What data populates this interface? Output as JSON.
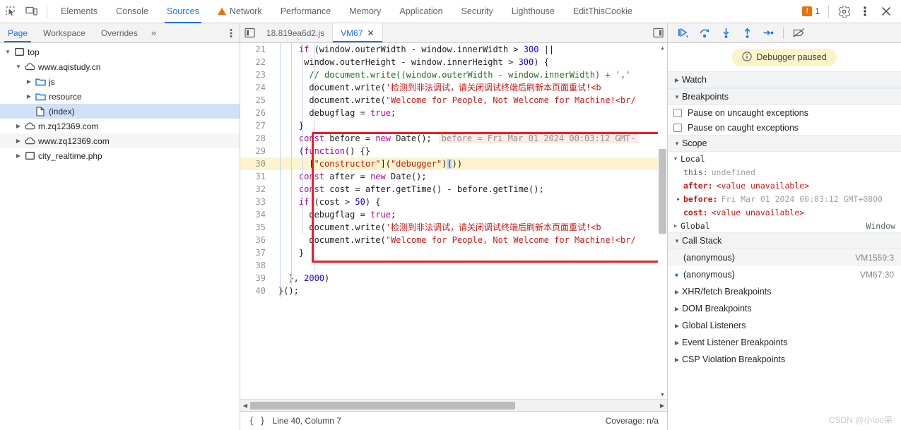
{
  "toolbar": {
    "inspect_icon": "inspect-cursor-icon",
    "device_icon": "device-toolbar-icon",
    "tabs": [
      {
        "label": "Elements",
        "active": false,
        "warning": false
      },
      {
        "label": "Console",
        "active": false,
        "warning": false
      },
      {
        "label": "Sources",
        "active": true,
        "warning": false
      },
      {
        "label": "Network",
        "active": false,
        "warning": true
      },
      {
        "label": "Performance",
        "active": false,
        "warning": false
      },
      {
        "label": "Memory",
        "active": false,
        "warning": false
      },
      {
        "label": "Application",
        "active": false,
        "warning": false
      },
      {
        "label": "Security",
        "active": false,
        "warning": false
      },
      {
        "label": "Lighthouse",
        "active": false,
        "warning": false
      },
      {
        "label": "EditThisCookie",
        "active": false,
        "warning": false
      }
    ],
    "warning_badge": {
      "symbol": "!",
      "count": "1"
    },
    "settings_icon": "gear-icon",
    "kebab_icon": "more-vertical-icon",
    "close_icon": "close-icon"
  },
  "navigator": {
    "tabs": [
      {
        "label": "Page",
        "active": true
      },
      {
        "label": "Workspace",
        "active": false
      },
      {
        "label": "Overrides",
        "active": false
      }
    ],
    "more_label": "»",
    "kebab_icon": "more-vertical-icon",
    "tree": [
      {
        "label": "top",
        "icon": "frame-icon",
        "depth": 0,
        "twisty": "▼",
        "selected": false,
        "striped": false
      },
      {
        "label": "www.aqistudy.cn",
        "icon": "cloud-icon",
        "depth": 1,
        "twisty": "▼",
        "selected": false,
        "striped": false
      },
      {
        "label": "js",
        "icon": "folder-icon",
        "depth": 2,
        "twisty": "▶",
        "selected": false,
        "striped": false
      },
      {
        "label": "resource",
        "icon": "folder-icon",
        "depth": 2,
        "twisty": "▶",
        "selected": false,
        "striped": false
      },
      {
        "label": "(index)",
        "icon": "document-icon",
        "depth": 2,
        "twisty": "",
        "selected": true,
        "striped": false
      },
      {
        "label": "m.zq12369.com",
        "icon": "cloud-icon",
        "depth": 1,
        "twisty": "▶",
        "selected": false,
        "striped": false
      },
      {
        "label": "www.zq12369.com",
        "icon": "cloud-icon",
        "depth": 1,
        "twisty": "▶",
        "selected": false,
        "striped": true
      },
      {
        "label": "city_realtime.php",
        "icon": "frame-icon",
        "depth": 1,
        "twisty": "▶",
        "selected": false,
        "striped": false
      }
    ]
  },
  "editor": {
    "nav_left_icon": "panel-collapse-left-icon",
    "nav_right_icon": "panel-expand-right-icon",
    "tabs": [
      {
        "label": "18.819ea6d2.js",
        "active": false,
        "closable": false
      },
      {
        "label": "VM67",
        "active": true,
        "closable": true,
        "close_label": "✕"
      }
    ],
    "highlighted_line": 30,
    "inline_evaluation": "before = Fri Mar 01 2024 00:03:12 GMT-",
    "lines": [
      {
        "num": "21",
        "code": "    if (window.outerWidth - window.innerWidth > 300 ||"
      },
      {
        "num": "22",
        "code": "     window.outerHeight - window.innerHeight > 300) {"
      },
      {
        "num": "23",
        "code": "      // document.write((window.outerWidth - window.innerWidth) + ','"
      },
      {
        "num": "24",
        "code": "      document.write('检测到非法调试，请关闭调试终端后刷新本页面重试!<b"
      },
      {
        "num": "25",
        "code": "      document.write(\"Welcome for People, Not Welcome for Machine!<br/"
      },
      {
        "num": "26",
        "code": "      debugflag = true;"
      },
      {
        "num": "27",
        "code": "    }"
      },
      {
        "num": "28",
        "code": "    const before = new Date();"
      },
      {
        "num": "29",
        "code": "    (function() {}"
      },
      {
        "num": "30",
        "code": "      [\"constructor\"](\"debugger\")())"
      },
      {
        "num": "31",
        "code": "    const after = new Date();"
      },
      {
        "num": "32",
        "code": "    const cost = after.getTime() - before.getTime();"
      },
      {
        "num": "33",
        "code": "    if (cost > 50) {"
      },
      {
        "num": "34",
        "code": "      debugflag = true;"
      },
      {
        "num": "35",
        "code": "      document.write('检测到非法调试，请关闭调试终端后刷新本页面重试!<b"
      },
      {
        "num": "36",
        "code": "      document.write(\"Welcome for People, Not Welcome for Machine!<br/"
      },
      {
        "num": "37",
        "code": "    }"
      },
      {
        "num": "38",
        "code": ""
      },
      {
        "num": "39",
        "code": "  }, 2000)"
      },
      {
        "num": "40",
        "code": "}();"
      }
    ]
  },
  "status_bar": {
    "pretty_print_icon": "format-braces-icon",
    "position": "Line 40, Column 7",
    "coverage": "Coverage: n/a"
  },
  "debugger": {
    "controls": [
      {
        "name": "resume-script-icon",
        "glyph": "▷"
      },
      {
        "name": "step-over-icon",
        "glyph": "↷"
      },
      {
        "name": "step-into-icon",
        "glyph": "↓"
      },
      {
        "name": "step-out-icon",
        "glyph": "↑"
      },
      {
        "name": "step-icon",
        "glyph": "→"
      },
      {
        "name": "deactivate-breakpoints-icon",
        "glyph": "⊘"
      }
    ],
    "paused_message": "Debugger paused",
    "paused_icon": "info-circle-icon",
    "sections": {
      "watch": {
        "label": "Watch",
        "twisty": "▶"
      },
      "breakpoints": {
        "label": "Breakpoints",
        "twisty": "▼"
      },
      "scope": {
        "label": "Scope",
        "twisty": "▼"
      },
      "call_stack": {
        "label": "Call Stack",
        "twisty": "▼"
      }
    },
    "pause_options": [
      {
        "label": "Pause on uncaught exceptions",
        "checked": false
      },
      {
        "label": "Pause on caught exceptions",
        "checked": false
      }
    ],
    "scope": {
      "local_label": "Local",
      "local_twisty": "▼",
      "entries": [
        {
          "name": "this:",
          "value": "undefined",
          "twisty": "",
          "bold": false,
          "error": false
        },
        {
          "name": "after:",
          "value": "<value unavailable>",
          "twisty": "",
          "bold": true,
          "error": true
        },
        {
          "name": "before:",
          "value": "Fri Mar 01 2024 00:03:12 GMT+0800",
          "twisty": "▶",
          "bold": true,
          "error": false
        },
        {
          "name": "cost:",
          "value": "<value unavailable>",
          "twisty": "",
          "bold": true,
          "error": true
        }
      ],
      "global_label": "Global",
      "global_twisty": "▶",
      "global_value": "Window"
    },
    "call_stack": [
      {
        "label": "(anonymous)",
        "location": "VM1559:3",
        "current": false
      },
      {
        "label": "(anonymous)",
        "location": "VM67:30",
        "current": true
      }
    ],
    "accordions": [
      {
        "label": "XHR/fetch Breakpoints",
        "twisty": "▶"
      },
      {
        "label": "DOM Breakpoints",
        "twisty": "▶"
      },
      {
        "label": "Global Listeners",
        "twisty": "▶"
      },
      {
        "label": "Event Listener Breakpoints",
        "twisty": "▶"
      },
      {
        "label": "CSP Violation Breakpoints",
        "twisty": "▶"
      }
    ],
    "watermark": "CSDN @小\\oo呆"
  },
  "colors": {
    "accent": "#1a73e8",
    "warning": "#e8710a",
    "highlight_line": "#fdf4cd",
    "annotation_box": "#ee1c25",
    "selection": "#cfe0f7"
  }
}
